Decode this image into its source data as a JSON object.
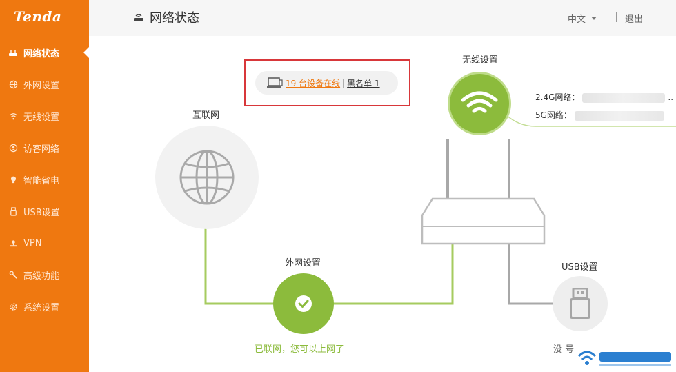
{
  "brand": "Tenda",
  "sidebar": {
    "items": [
      {
        "label": "网络状态",
        "icon": "router-icon",
        "active": true
      },
      {
        "label": "外网设置",
        "icon": "globe-icon"
      },
      {
        "label": "无线设置",
        "icon": "wifi-icon"
      },
      {
        "label": "访客网络",
        "icon": "guest-icon"
      },
      {
        "label": "智能省电",
        "icon": "bulb-icon"
      },
      {
        "label": "USB设置",
        "icon": "usb-icon"
      },
      {
        "label": "VPN",
        "icon": "vpn-icon"
      },
      {
        "label": "高级功能",
        "icon": "wrench-icon"
      },
      {
        "label": "系统设置",
        "icon": "gear-icon"
      }
    ]
  },
  "header": {
    "title": "网络状态",
    "language": "中文",
    "logout": "退出"
  },
  "main": {
    "internet_label": "互联网",
    "devices_online": "19 台设备在线",
    "pill_separator": "|",
    "blacklist": "黑名单 1",
    "wireless_label": "无线设置",
    "wifi_24_label": "2.4G网络：",
    "wifi_24_suffix": "..",
    "wifi_5_label": "5G网络：",
    "wan_label": "外网设置",
    "usb_label": "USB设置",
    "status_text": "已联网，您可以上网了",
    "usb_status_partial": "没 号"
  },
  "colors": {
    "sidebar": "#ef7810",
    "green": "#8cbb3c",
    "alert_box": "#d8373a"
  }
}
